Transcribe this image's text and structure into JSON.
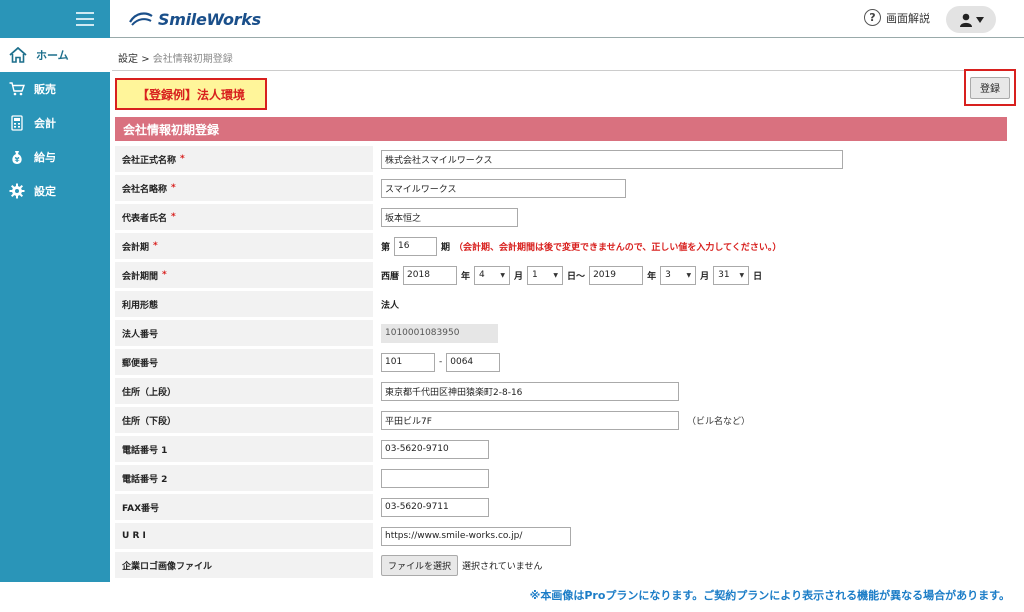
{
  "header": {
    "logo_text": "SmileWorks",
    "help_label": "画面解説",
    "help_icon": "question-circle-icon",
    "user_icon": "user-icon"
  },
  "sidebar": {
    "items": [
      {
        "label": "ホーム",
        "icon": "home-icon",
        "active": true
      },
      {
        "label": "販売",
        "icon": "cart-icon"
      },
      {
        "label": "会計",
        "icon": "calculator-icon"
      },
      {
        "label": "給与",
        "icon": "money-bag-icon"
      },
      {
        "label": "設定",
        "icon": "gear-icon"
      }
    ]
  },
  "breadcrumb": {
    "parent": "設定",
    "separator": ">",
    "current": "会社情報初期登録"
  },
  "example_label": "【登録例】法人環境",
  "register_label": "登録",
  "section_title": "会社情報初期登録",
  "form": {
    "company_name": {
      "label": "会社正式名称",
      "required": "*",
      "value": "株式会社スマイルワークス"
    },
    "company_short": {
      "label": "会社名略称",
      "required": "*",
      "value": "スマイルワークス"
    },
    "representative": {
      "label": "代表者氏名",
      "required": "*",
      "value": "坂本恒之"
    },
    "fiscal_term": {
      "label": "会計期",
      "required": "*",
      "prefix": "第",
      "value": "16",
      "suffix": "期",
      "note": "（会計期、会計期間は後で変更できませんので、正しい値を入力してください。）"
    },
    "fiscal_period": {
      "label": "会計期間",
      "required": "*",
      "era": "西暦",
      "start_year": "2018",
      "year_unit": "年",
      "start_month": "4",
      "month_unit": "月",
      "start_day": "1",
      "range_sep": "日〜",
      "end_year": "2019",
      "end_month": "3",
      "end_day": "31",
      "day_unit": "日"
    },
    "usage_type": {
      "label": "利用形態",
      "value": "法人"
    },
    "corporate_number": {
      "label": "法人番号",
      "value": "1010001083950"
    },
    "postal_code": {
      "label": "郵便番号",
      "part1": "101",
      "dash": "-",
      "part2": "0064"
    },
    "address1": {
      "label": "住所（上段）",
      "value": "東京都千代田区神田猿楽町2-8-16"
    },
    "address2": {
      "label": "住所（下段）",
      "value": "平田ビル7F",
      "hint": "（ビル名など）"
    },
    "phone1": {
      "label": "電話番号 1",
      "value": "03-5620-9710"
    },
    "phone2": {
      "label": "電話番号 2",
      "value": ""
    },
    "fax": {
      "label": "FAX番号",
      "value": "03-5620-9711"
    },
    "uri": {
      "label": "U R I",
      "value": "https://www.smile-works.co.jp/"
    },
    "logo_file": {
      "label": "企業ロゴ画像ファイル",
      "button": "ファイルを選択",
      "status": "選択されていません"
    }
  },
  "footer_note": "※本画像はProプランになります。ご契約プランにより表示される機能が異なる場合があります。",
  "colors": {
    "sidebar": "#2a95b8",
    "section_header": "#d9717f",
    "highlight_red": "#d8201e",
    "highlight_yellow": "#fff59a",
    "note_blue": "#1c7dc7"
  }
}
